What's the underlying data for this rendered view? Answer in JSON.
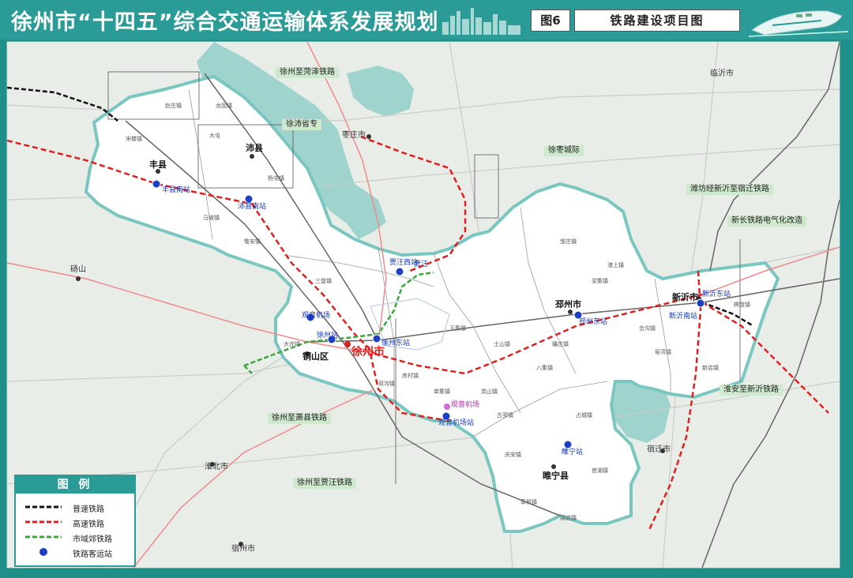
{
  "header": {
    "title": "徐州市“十四五”综合交通运输体系发展规划",
    "figure_label": "图6",
    "figure_title": "铁路建设项目图"
  },
  "colors": {
    "frame": "#2a9b96",
    "conventional_rail": "#111111",
    "high_speed_rail": "#e0201f",
    "suburban_rail": "#3aa83a",
    "station": "#1c3fc4",
    "xuzhou_region": "#ffffff",
    "water": "#9fd3cd"
  },
  "legend": {
    "title": "图 例",
    "items": [
      {
        "label": "普速铁路",
        "symbol": "black-dashed-line"
      },
      {
        "label": "高速铁路",
        "symbol": "red-dashed-line"
      },
      {
        "label": "市域郊铁路",
        "symbol": "green-dashed-line"
      },
      {
        "label": "铁路客运站",
        "symbol": "blue-station-icon"
      }
    ]
  },
  "cities": {
    "xuzhou": "徐州市",
    "tongshan": "铜山区",
    "fengxian": "丰县",
    "peixian": "沛县",
    "pizhou": "邳州市",
    "xinyi": "新沂市",
    "suining": "睢宁县",
    "zaozhuang": "枣庄市",
    "linyi": "临沂市",
    "suqian": "宿迁市",
    "huaibei": "淮北市",
    "suzhou": "宿州市",
    "dangshan": "砀山"
  },
  "rail_projects": {
    "xuzhou_heze": "徐州至菏泽铁路",
    "xu_pei": "徐沛省专",
    "xu_zao": "徐枣城际",
    "weifang_xinyi": "潍坊经新沂至宿迁铁路",
    "xinchang_electrification": "新长铁路电气化改造",
    "huaian_xinyi": "淮安至新沂铁路",
    "xuzhou_xiaoxian": "徐州至萧县铁路",
    "xuzhou_jiawang": "徐州至贾汪铁路"
  },
  "stations": {
    "fengxian_south": "丰县南站",
    "peixian_south": "沛县南站",
    "jiawang_west": "贾汪西站",
    "jiawang": "贾汪",
    "xuzhou_east": "徐州东站",
    "xuzhou_station": "徐州站",
    "guanyin": "观音机场",
    "pizhou_east": "邳州东站",
    "xinyi_east": "新沂东站",
    "xinyi_south": "新沂南站",
    "suining_station": "睢宁站",
    "airport": "观音机场",
    "airport_station": "观音机场站"
  },
  "towns": [
    "赵庄镇",
    "宋楼镇",
    "大屯",
    "龙固镇",
    "杨屯镇",
    "敬安镇",
    "马坡镇",
    "三堡镇",
    "大许镇",
    "房村镇",
    "单集镇",
    "双沟镇",
    "岚山镇",
    "古邳镇",
    "庆安镇",
    "八集镇",
    "占城镇",
    "官湖镇",
    "土山镇",
    "碾庄镇",
    "港上镇",
    "邹庄镇",
    "窑湾镇",
    "新店镇",
    "合沟镇",
    "棋盘镇",
    "草桥镇",
    "邵店镇",
    "王集镇",
    "梁集镇"
  ]
}
